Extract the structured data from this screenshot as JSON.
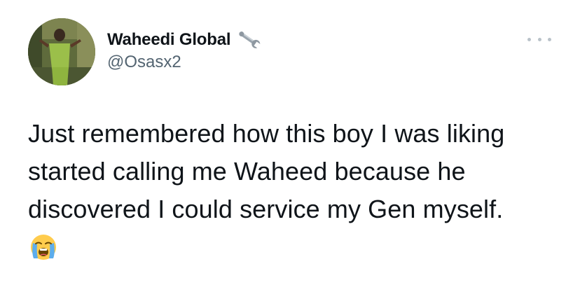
{
  "tweet": {
    "author": {
      "display_name": "Waheedi Global",
      "handle": "@Osasx2",
      "name_badge_icon": "wrench-icon",
      "avatar_icon": "avatar"
    },
    "more_icon": "more-horizontal-icon",
    "text_lines": [
      "Just remembered how this boy I was liking",
      "started calling me Waheed because he",
      "discovered I could service my Gen myself."
    ],
    "emoji": "😭",
    "emoji_icon": "loudly-crying-face-emoji",
    "colors": {
      "text": "#0f1419",
      "secondary": "#536471",
      "more_dots": "#b9c2c9",
      "background": "#ffffff"
    }
  }
}
